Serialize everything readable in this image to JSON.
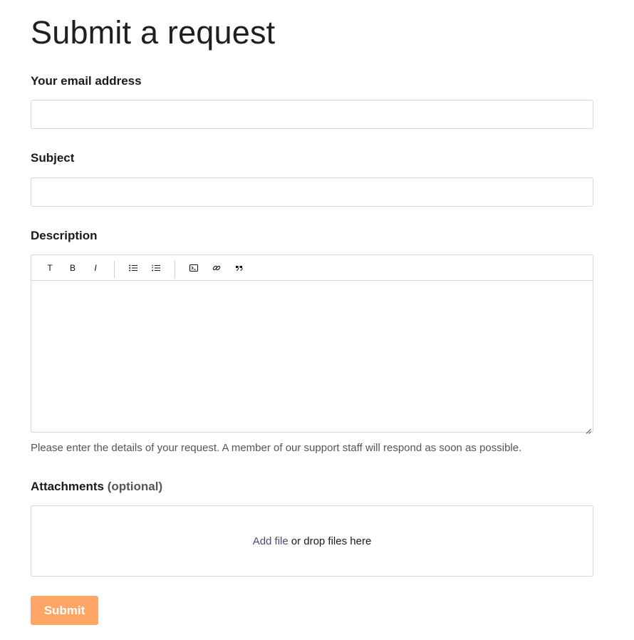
{
  "page": {
    "title": "Submit a request"
  },
  "fields": {
    "email": {
      "label": "Your email address",
      "value": "",
      "placeholder": ""
    },
    "subject": {
      "label": "Subject",
      "value": "",
      "placeholder": ""
    },
    "description": {
      "label": "Description",
      "value": "",
      "hint": "Please enter the details of your request. A member of our support staff will respond as soon as possible."
    },
    "attachments": {
      "label": "Attachments",
      "optional_label": "(optional)",
      "add_file_label": "Add file",
      "drop_label": "or drop files here"
    }
  },
  "toolbar": {
    "text_label": "T",
    "bold_label": "B",
    "italic_label": "I",
    "icons": [
      "text-style-icon",
      "bold-icon",
      "italic-icon",
      "bulleted-list-icon",
      "numbered-list-icon",
      "code-block-icon",
      "link-icon",
      "quote-icon"
    ]
  },
  "actions": {
    "submit_label": "Submit"
  },
  "colors": {
    "submit_background": "#ffa566",
    "link": "#4b4b7c",
    "border": "#d8d8d8"
  }
}
